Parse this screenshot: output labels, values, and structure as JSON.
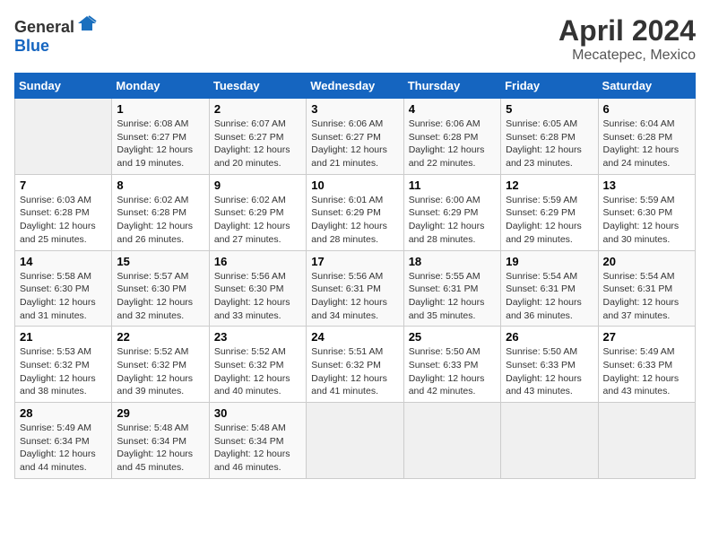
{
  "header": {
    "logo_general": "General",
    "logo_blue": "Blue",
    "month": "April 2024",
    "location": "Mecatepec, Mexico"
  },
  "days_of_week": [
    "Sunday",
    "Monday",
    "Tuesday",
    "Wednesday",
    "Thursday",
    "Friday",
    "Saturday"
  ],
  "weeks": [
    [
      {
        "day": "",
        "empty": true
      },
      {
        "day": "1",
        "sunrise": "Sunrise: 6:08 AM",
        "sunset": "Sunset: 6:27 PM",
        "daylight": "Daylight: 12 hours and 19 minutes."
      },
      {
        "day": "2",
        "sunrise": "Sunrise: 6:07 AM",
        "sunset": "Sunset: 6:27 PM",
        "daylight": "Daylight: 12 hours and 20 minutes."
      },
      {
        "day": "3",
        "sunrise": "Sunrise: 6:06 AM",
        "sunset": "Sunset: 6:27 PM",
        "daylight": "Daylight: 12 hours and 21 minutes."
      },
      {
        "day": "4",
        "sunrise": "Sunrise: 6:06 AM",
        "sunset": "Sunset: 6:28 PM",
        "daylight": "Daylight: 12 hours and 22 minutes."
      },
      {
        "day": "5",
        "sunrise": "Sunrise: 6:05 AM",
        "sunset": "Sunset: 6:28 PM",
        "daylight": "Daylight: 12 hours and 23 minutes."
      },
      {
        "day": "6",
        "sunrise": "Sunrise: 6:04 AM",
        "sunset": "Sunset: 6:28 PM",
        "daylight": "Daylight: 12 hours and 24 minutes."
      }
    ],
    [
      {
        "day": "7",
        "sunrise": "Sunrise: 6:03 AM",
        "sunset": "Sunset: 6:28 PM",
        "daylight": "Daylight: 12 hours and 25 minutes."
      },
      {
        "day": "8",
        "sunrise": "Sunrise: 6:02 AM",
        "sunset": "Sunset: 6:28 PM",
        "daylight": "Daylight: 12 hours and 26 minutes."
      },
      {
        "day": "9",
        "sunrise": "Sunrise: 6:02 AM",
        "sunset": "Sunset: 6:29 PM",
        "daylight": "Daylight: 12 hours and 27 minutes."
      },
      {
        "day": "10",
        "sunrise": "Sunrise: 6:01 AM",
        "sunset": "Sunset: 6:29 PM",
        "daylight": "Daylight: 12 hours and 28 minutes."
      },
      {
        "day": "11",
        "sunrise": "Sunrise: 6:00 AM",
        "sunset": "Sunset: 6:29 PM",
        "daylight": "Daylight: 12 hours and 28 minutes."
      },
      {
        "day": "12",
        "sunrise": "Sunrise: 5:59 AM",
        "sunset": "Sunset: 6:29 PM",
        "daylight": "Daylight: 12 hours and 29 minutes."
      },
      {
        "day": "13",
        "sunrise": "Sunrise: 5:59 AM",
        "sunset": "Sunset: 6:30 PM",
        "daylight": "Daylight: 12 hours and 30 minutes."
      }
    ],
    [
      {
        "day": "14",
        "sunrise": "Sunrise: 5:58 AM",
        "sunset": "Sunset: 6:30 PM",
        "daylight": "Daylight: 12 hours and 31 minutes."
      },
      {
        "day": "15",
        "sunrise": "Sunrise: 5:57 AM",
        "sunset": "Sunset: 6:30 PM",
        "daylight": "Daylight: 12 hours and 32 minutes."
      },
      {
        "day": "16",
        "sunrise": "Sunrise: 5:56 AM",
        "sunset": "Sunset: 6:30 PM",
        "daylight": "Daylight: 12 hours and 33 minutes."
      },
      {
        "day": "17",
        "sunrise": "Sunrise: 5:56 AM",
        "sunset": "Sunset: 6:31 PM",
        "daylight": "Daylight: 12 hours and 34 minutes."
      },
      {
        "day": "18",
        "sunrise": "Sunrise: 5:55 AM",
        "sunset": "Sunset: 6:31 PM",
        "daylight": "Daylight: 12 hours and 35 minutes."
      },
      {
        "day": "19",
        "sunrise": "Sunrise: 5:54 AM",
        "sunset": "Sunset: 6:31 PM",
        "daylight": "Daylight: 12 hours and 36 minutes."
      },
      {
        "day": "20",
        "sunrise": "Sunrise: 5:54 AM",
        "sunset": "Sunset: 6:31 PM",
        "daylight": "Daylight: 12 hours and 37 minutes."
      }
    ],
    [
      {
        "day": "21",
        "sunrise": "Sunrise: 5:53 AM",
        "sunset": "Sunset: 6:32 PM",
        "daylight": "Daylight: 12 hours and 38 minutes."
      },
      {
        "day": "22",
        "sunrise": "Sunrise: 5:52 AM",
        "sunset": "Sunset: 6:32 PM",
        "daylight": "Daylight: 12 hours and 39 minutes."
      },
      {
        "day": "23",
        "sunrise": "Sunrise: 5:52 AM",
        "sunset": "Sunset: 6:32 PM",
        "daylight": "Daylight: 12 hours and 40 minutes."
      },
      {
        "day": "24",
        "sunrise": "Sunrise: 5:51 AM",
        "sunset": "Sunset: 6:32 PM",
        "daylight": "Daylight: 12 hours and 41 minutes."
      },
      {
        "day": "25",
        "sunrise": "Sunrise: 5:50 AM",
        "sunset": "Sunset: 6:33 PM",
        "daylight": "Daylight: 12 hours and 42 minutes."
      },
      {
        "day": "26",
        "sunrise": "Sunrise: 5:50 AM",
        "sunset": "Sunset: 6:33 PM",
        "daylight": "Daylight: 12 hours and 43 minutes."
      },
      {
        "day": "27",
        "sunrise": "Sunrise: 5:49 AM",
        "sunset": "Sunset: 6:33 PM",
        "daylight": "Daylight: 12 hours and 43 minutes."
      }
    ],
    [
      {
        "day": "28",
        "sunrise": "Sunrise: 5:49 AM",
        "sunset": "Sunset: 6:34 PM",
        "daylight": "Daylight: 12 hours and 44 minutes."
      },
      {
        "day": "29",
        "sunrise": "Sunrise: 5:48 AM",
        "sunset": "Sunset: 6:34 PM",
        "daylight": "Daylight: 12 hours and 45 minutes."
      },
      {
        "day": "30",
        "sunrise": "Sunrise: 5:48 AM",
        "sunset": "Sunset: 6:34 PM",
        "daylight": "Daylight: 12 hours and 46 minutes."
      },
      {
        "day": "",
        "empty": true
      },
      {
        "day": "",
        "empty": true
      },
      {
        "day": "",
        "empty": true
      },
      {
        "day": "",
        "empty": true
      }
    ]
  ]
}
